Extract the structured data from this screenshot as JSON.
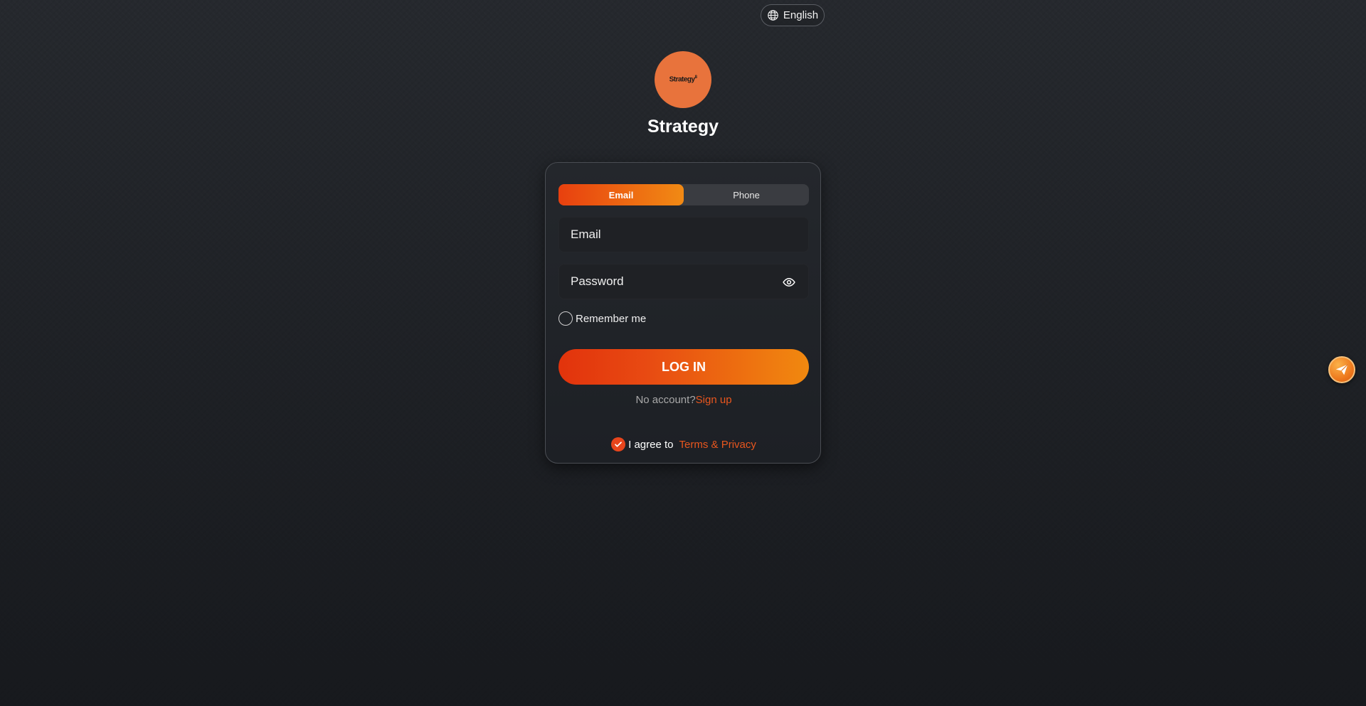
{
  "language": {
    "label": "English",
    "icon": "globe-icon"
  },
  "brand": {
    "logo_text": "Strategy",
    "logo_sup": "8",
    "title": "Strategy"
  },
  "login": {
    "tabs": [
      {
        "label": "Email",
        "active": true
      },
      {
        "label": "Phone",
        "active": false
      }
    ],
    "email_placeholder": "Email",
    "password_placeholder": "Password",
    "remember_label": "Remember me",
    "submit_label": "LOG IN",
    "no_account_text": "No account?",
    "signup_link": "Sign up",
    "agree_text": "I agree to",
    "terms_link": "Terms & Privacy",
    "agree_checked": true
  },
  "colors": {
    "accent": "#e8451c",
    "accent_end": "#f18a14",
    "logo_bg": "#e8733c",
    "card_bg": "#24272c"
  },
  "floating_button": {
    "icon": "paper-plane-icon"
  }
}
